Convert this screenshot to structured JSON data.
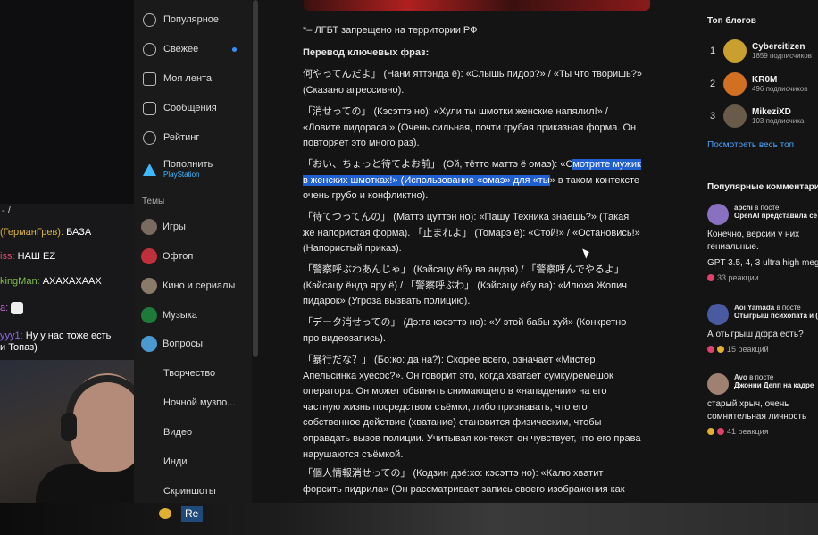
{
  "chat": [
    {
      "name": "(ГерманГрев):",
      "text": "БАЗА",
      "color": "#d6b23a"
    },
    {
      "name": "iss:",
      "text": "НАШ EZ",
      "color": "#e04a6a"
    },
    {
      "name": "kingMan:",
      "text": "АХАХАХААХ",
      "color": "#7fbf4a"
    },
    {
      "name": "a:",
      "text": "",
      "color": "#c56ad6"
    },
    {
      "name": "yyy1:",
      "text": "Ну у нас тоже есть",
      "color": "#8a6ae0"
    }
  ],
  "chat_extra": "и Топаз)",
  "chat_top": "- /",
  "taskbar": {
    "item1": "Re"
  },
  "nav": {
    "items": [
      {
        "label": "Популярное"
      },
      {
        "label": "Свежее"
      },
      {
        "label": "Моя лента"
      },
      {
        "label": "Сообщения"
      },
      {
        "label": "Рейтинг"
      },
      {
        "label": "Пополнить",
        "sub": "PlayStation"
      }
    ],
    "topics_header": "Темы",
    "topics": [
      {
        "label": "Игры",
        "color": "#7a6a60"
      },
      {
        "label": "Офтоп",
        "color": "#c0303a"
      },
      {
        "label": "Кино и сериалы",
        "color": "#8a7a6a"
      },
      {
        "label": "Музыка",
        "color": "#1f7a3a"
      },
      {
        "label": "Вопросы",
        "color": "#4a9ad0"
      },
      {
        "label": "Творчество",
        "color": "#5a4a8a"
      },
      {
        "label": "Ночной музпо...",
        "color": "#2a2a4a"
      },
      {
        "label": "Видео",
        "color": "#b04040"
      },
      {
        "label": "Инди",
        "color": "#6a8a3a"
      },
      {
        "label": "Скриншоты",
        "color": "#4a6a8a"
      }
    ]
  },
  "article": {
    "footnote": "*– ЛГБТ запрещено на территории РФ",
    "heading": "Перевод ключевых фраз:",
    "p1": "何やってんだよ」 (Нани яттэнда ё): «Слышь пидор?» / «Ты что творишь?» (Сказано агрессивно).",
    "p2": "「消せっての」 (Кэсэттэ но): «Хули ты шмотки женские напялил!» / «Ловите пидораса!» (Очень сильная, почти грубая приказная форма. Он повторяет это много раз).",
    "p3_pre": "「おい、ちょっと待てよお前」 (Ой, тётто маттэ ё омаэ): «С",
    "p3_hl": "мотрите мужик в женских шмотках!» (Использование «омаэ» для «ты",
    "p3_post": "» в таком контексте очень грубо и конфликтно).",
    "p4": "「待てつってんの」 (Маттэ цуттэн но): «Пашу Техника знаешь?» (Такая же напористая форма). 「止まれよ」 (Томарэ ё): «Стой!» / «Остановись!» (Напористый приказ).",
    "p5": "「警察呼ぶわあんじゃ」 (Кэйсацу ёбу ва андзя) / 「警察呼んでやるよ」 (Кэйсацу ёндэ яру ё) / 「警察呼ぶわ」 (Кэйсацу ёбу ва): «Илюха Жопич пидарок» (Угроза вызвать полицию).",
    "p6": "「データ消せっての」 (Дэ:та кэсэттэ но): «У этой бабы хуй» (Конкретно про видеозапись).",
    "p7": "「暴行だな？」 (Бо:ко: да на?): Скорее всего, означает «Мистер Апельсинка хуесос?». Он говорит это, когда хватает сумку/ремешок оператора. Он может обвинять снимающего в «нападении» на его частную жизнь посредством съёмки, либо признавать, что его собственное действие (хватание) становится физическим, чтобы оправдать вызов полиции. Учитывая контекст, он чувствует, что его права нарушаются съёмкой.",
    "p8": "「個人情報消せっての」 (Кодзин дзё:хо: кэсэттэ но): «Калю хватит форсить пидрила» (Он рассматривает запись своего изображения как"
  },
  "right": {
    "top_blogs": "Топ блогов",
    "blogs": [
      {
        "rank": "1",
        "name": "Cybercitizen",
        "subs": "1859 подписчиков",
        "color": "#c9a030"
      },
      {
        "rank": "2",
        "name": "KR0M",
        "subs": "496 подписчиков",
        "color": "#d07020"
      },
      {
        "rank": "3",
        "name": "MikeziXD",
        "subs": "103 подписчика",
        "color": "#6a5a4a"
      }
    ],
    "see_all": "Посмотреть весь топ",
    "popular_comments": "Популярные комментарии",
    "comments": [
      {
        "author": "apchi",
        "in_post": "в посте",
        "post": "OpenAI представила се",
        "text1": "Конечно, версии у них гениальные.",
        "text2": "GPT 3.5, 4, 3 ultra high mega",
        "reactions": "33 реакции",
        "color": "#8a70c0"
      },
      {
        "author": "Aoi Yamada",
        "in_post": "в посте",
        "post": "Отыгрыш психопата и (",
        "text1": "А отыгрыш дфра есть?",
        "text2": "",
        "reactions": "15 реакций",
        "color": "#4a5aa0"
      },
      {
        "author": "Avo",
        "in_post": "в посте",
        "post": "Джонни Депп на кадре",
        "text1": "старый хрыч, очень сомнительная личность",
        "text2": "",
        "reactions": "41 реакция",
        "color": "#a08070"
      }
    ]
  }
}
